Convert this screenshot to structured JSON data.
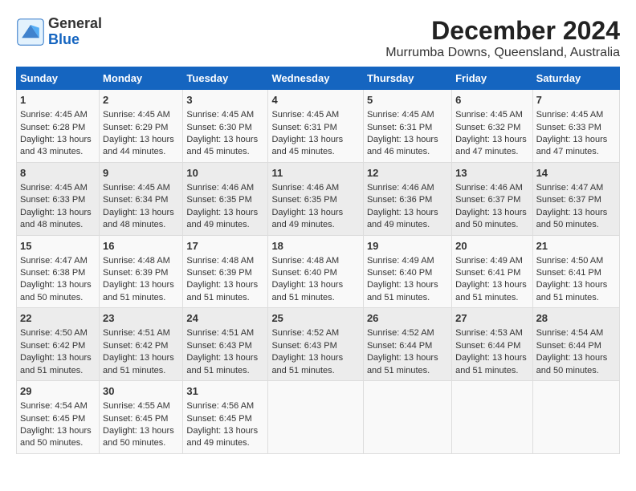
{
  "header": {
    "logo_general": "General",
    "logo_blue": "Blue",
    "title": "December 2024",
    "subtitle": "Murrumba Downs, Queensland, Australia"
  },
  "calendar": {
    "days_of_week": [
      "Sunday",
      "Monday",
      "Tuesday",
      "Wednesday",
      "Thursday",
      "Friday",
      "Saturday"
    ],
    "weeks": [
      [
        {
          "day": "1",
          "sunrise": "Sunrise: 4:45 AM",
          "sunset": "Sunset: 6:28 PM",
          "daylight": "Daylight: 13 hours and 43 minutes."
        },
        {
          "day": "2",
          "sunrise": "Sunrise: 4:45 AM",
          "sunset": "Sunset: 6:29 PM",
          "daylight": "Daylight: 13 hours and 44 minutes."
        },
        {
          "day": "3",
          "sunrise": "Sunrise: 4:45 AM",
          "sunset": "Sunset: 6:30 PM",
          "daylight": "Daylight: 13 hours and 45 minutes."
        },
        {
          "day": "4",
          "sunrise": "Sunrise: 4:45 AM",
          "sunset": "Sunset: 6:31 PM",
          "daylight": "Daylight: 13 hours and 45 minutes."
        },
        {
          "day": "5",
          "sunrise": "Sunrise: 4:45 AM",
          "sunset": "Sunset: 6:31 PM",
          "daylight": "Daylight: 13 hours and 46 minutes."
        },
        {
          "day": "6",
          "sunrise": "Sunrise: 4:45 AM",
          "sunset": "Sunset: 6:32 PM",
          "daylight": "Daylight: 13 hours and 47 minutes."
        },
        {
          "day": "7",
          "sunrise": "Sunrise: 4:45 AM",
          "sunset": "Sunset: 6:33 PM",
          "daylight": "Daylight: 13 hours and 47 minutes."
        }
      ],
      [
        {
          "day": "8",
          "sunrise": "Sunrise: 4:45 AM",
          "sunset": "Sunset: 6:33 PM",
          "daylight": "Daylight: 13 hours and 48 minutes."
        },
        {
          "day": "9",
          "sunrise": "Sunrise: 4:45 AM",
          "sunset": "Sunset: 6:34 PM",
          "daylight": "Daylight: 13 hours and 48 minutes."
        },
        {
          "day": "10",
          "sunrise": "Sunrise: 4:46 AM",
          "sunset": "Sunset: 6:35 PM",
          "daylight": "Daylight: 13 hours and 49 minutes."
        },
        {
          "day": "11",
          "sunrise": "Sunrise: 4:46 AM",
          "sunset": "Sunset: 6:35 PM",
          "daylight": "Daylight: 13 hours and 49 minutes."
        },
        {
          "day": "12",
          "sunrise": "Sunrise: 4:46 AM",
          "sunset": "Sunset: 6:36 PM",
          "daylight": "Daylight: 13 hours and 49 minutes."
        },
        {
          "day": "13",
          "sunrise": "Sunrise: 4:46 AM",
          "sunset": "Sunset: 6:37 PM",
          "daylight": "Daylight: 13 hours and 50 minutes."
        },
        {
          "day": "14",
          "sunrise": "Sunrise: 4:47 AM",
          "sunset": "Sunset: 6:37 PM",
          "daylight": "Daylight: 13 hours and 50 minutes."
        }
      ],
      [
        {
          "day": "15",
          "sunrise": "Sunrise: 4:47 AM",
          "sunset": "Sunset: 6:38 PM",
          "daylight": "Daylight: 13 hours and 50 minutes."
        },
        {
          "day": "16",
          "sunrise": "Sunrise: 4:48 AM",
          "sunset": "Sunset: 6:39 PM",
          "daylight": "Daylight: 13 hours and 51 minutes."
        },
        {
          "day": "17",
          "sunrise": "Sunrise: 4:48 AM",
          "sunset": "Sunset: 6:39 PM",
          "daylight": "Daylight: 13 hours and 51 minutes."
        },
        {
          "day": "18",
          "sunrise": "Sunrise: 4:48 AM",
          "sunset": "Sunset: 6:40 PM",
          "daylight": "Daylight: 13 hours and 51 minutes."
        },
        {
          "day": "19",
          "sunrise": "Sunrise: 4:49 AM",
          "sunset": "Sunset: 6:40 PM",
          "daylight": "Daylight: 13 hours and 51 minutes."
        },
        {
          "day": "20",
          "sunrise": "Sunrise: 4:49 AM",
          "sunset": "Sunset: 6:41 PM",
          "daylight": "Daylight: 13 hours and 51 minutes."
        },
        {
          "day": "21",
          "sunrise": "Sunrise: 4:50 AM",
          "sunset": "Sunset: 6:41 PM",
          "daylight": "Daylight: 13 hours and 51 minutes."
        }
      ],
      [
        {
          "day": "22",
          "sunrise": "Sunrise: 4:50 AM",
          "sunset": "Sunset: 6:42 PM",
          "daylight": "Daylight: 13 hours and 51 minutes."
        },
        {
          "day": "23",
          "sunrise": "Sunrise: 4:51 AM",
          "sunset": "Sunset: 6:42 PM",
          "daylight": "Daylight: 13 hours and 51 minutes."
        },
        {
          "day": "24",
          "sunrise": "Sunrise: 4:51 AM",
          "sunset": "Sunset: 6:43 PM",
          "daylight": "Daylight: 13 hours and 51 minutes."
        },
        {
          "day": "25",
          "sunrise": "Sunrise: 4:52 AM",
          "sunset": "Sunset: 6:43 PM",
          "daylight": "Daylight: 13 hours and 51 minutes."
        },
        {
          "day": "26",
          "sunrise": "Sunrise: 4:52 AM",
          "sunset": "Sunset: 6:44 PM",
          "daylight": "Daylight: 13 hours and 51 minutes."
        },
        {
          "day": "27",
          "sunrise": "Sunrise: 4:53 AM",
          "sunset": "Sunset: 6:44 PM",
          "daylight": "Daylight: 13 hours and 51 minutes."
        },
        {
          "day": "28",
          "sunrise": "Sunrise: 4:54 AM",
          "sunset": "Sunset: 6:44 PM",
          "daylight": "Daylight: 13 hours and 50 minutes."
        }
      ],
      [
        {
          "day": "29",
          "sunrise": "Sunrise: 4:54 AM",
          "sunset": "Sunset: 6:45 PM",
          "daylight": "Daylight: 13 hours and 50 minutes."
        },
        {
          "day": "30",
          "sunrise": "Sunrise: 4:55 AM",
          "sunset": "Sunset: 6:45 PM",
          "daylight": "Daylight: 13 hours and 50 minutes."
        },
        {
          "day": "31",
          "sunrise": "Sunrise: 4:56 AM",
          "sunset": "Sunset: 6:45 PM",
          "daylight": "Daylight: 13 hours and 49 minutes."
        },
        null,
        null,
        null,
        null
      ]
    ]
  }
}
